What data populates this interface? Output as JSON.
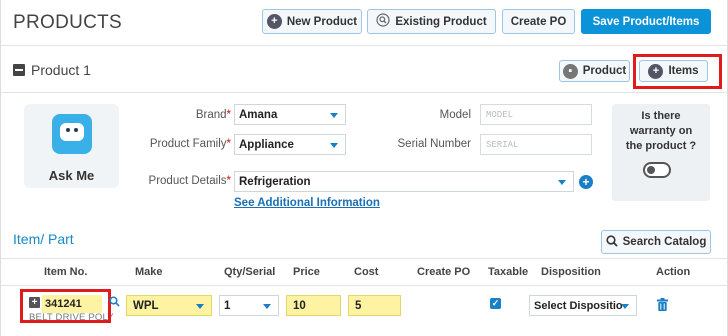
{
  "header": {
    "title": "PRODUCTS",
    "new_product": "New Product",
    "existing_product": "Existing Product",
    "create_po": "Create PO",
    "save": "Save Product/Items"
  },
  "product_section": {
    "title": "Product 1",
    "tab_product": "Product",
    "tab_items": "Items"
  },
  "askme": {
    "label": "Ask Me"
  },
  "form": {
    "brand_label": "Brand",
    "brand_value": "Amana",
    "model_label": "Model",
    "model_placeholder": "MODEL",
    "family_label": "Product Family",
    "family_value": "Appliance",
    "serial_label": "Serial Number",
    "serial_placeholder": "SERIAL",
    "details_label": "Product Details",
    "details_value": "Refrigeration",
    "additional_info_link": "See Additional Information",
    "required_mark": "*"
  },
  "warranty": {
    "line1": "Is there",
    "line2": "warranty on",
    "line3": "the product ?"
  },
  "items": {
    "title": "Item/ Part",
    "search_catalog": "Search Catalog",
    "columns": [
      "Item No.",
      "Make",
      "Qty/Serial",
      "Price",
      "Cost",
      "Create PO",
      "Taxable",
      "Disposition",
      "Action"
    ],
    "row": {
      "item_no": "341241",
      "item_desc": "BELT DRIVE POLY",
      "make": "WPL",
      "qty": "1",
      "price": "10",
      "cost": "5",
      "disposition": "Select Dispositio"
    }
  },
  "colors": {
    "accent": "#0a93d8",
    "highlight_red": "#e01b1b",
    "field_yellow": "#fdf3a3"
  },
  "icons": {
    "new_product": "plus-circle-icon",
    "existing_product": "search-icon",
    "tab_product": "box-icon",
    "tab_items": "plus-circle-icon",
    "search_catalog": "search-icon",
    "action": "trash-icon"
  }
}
